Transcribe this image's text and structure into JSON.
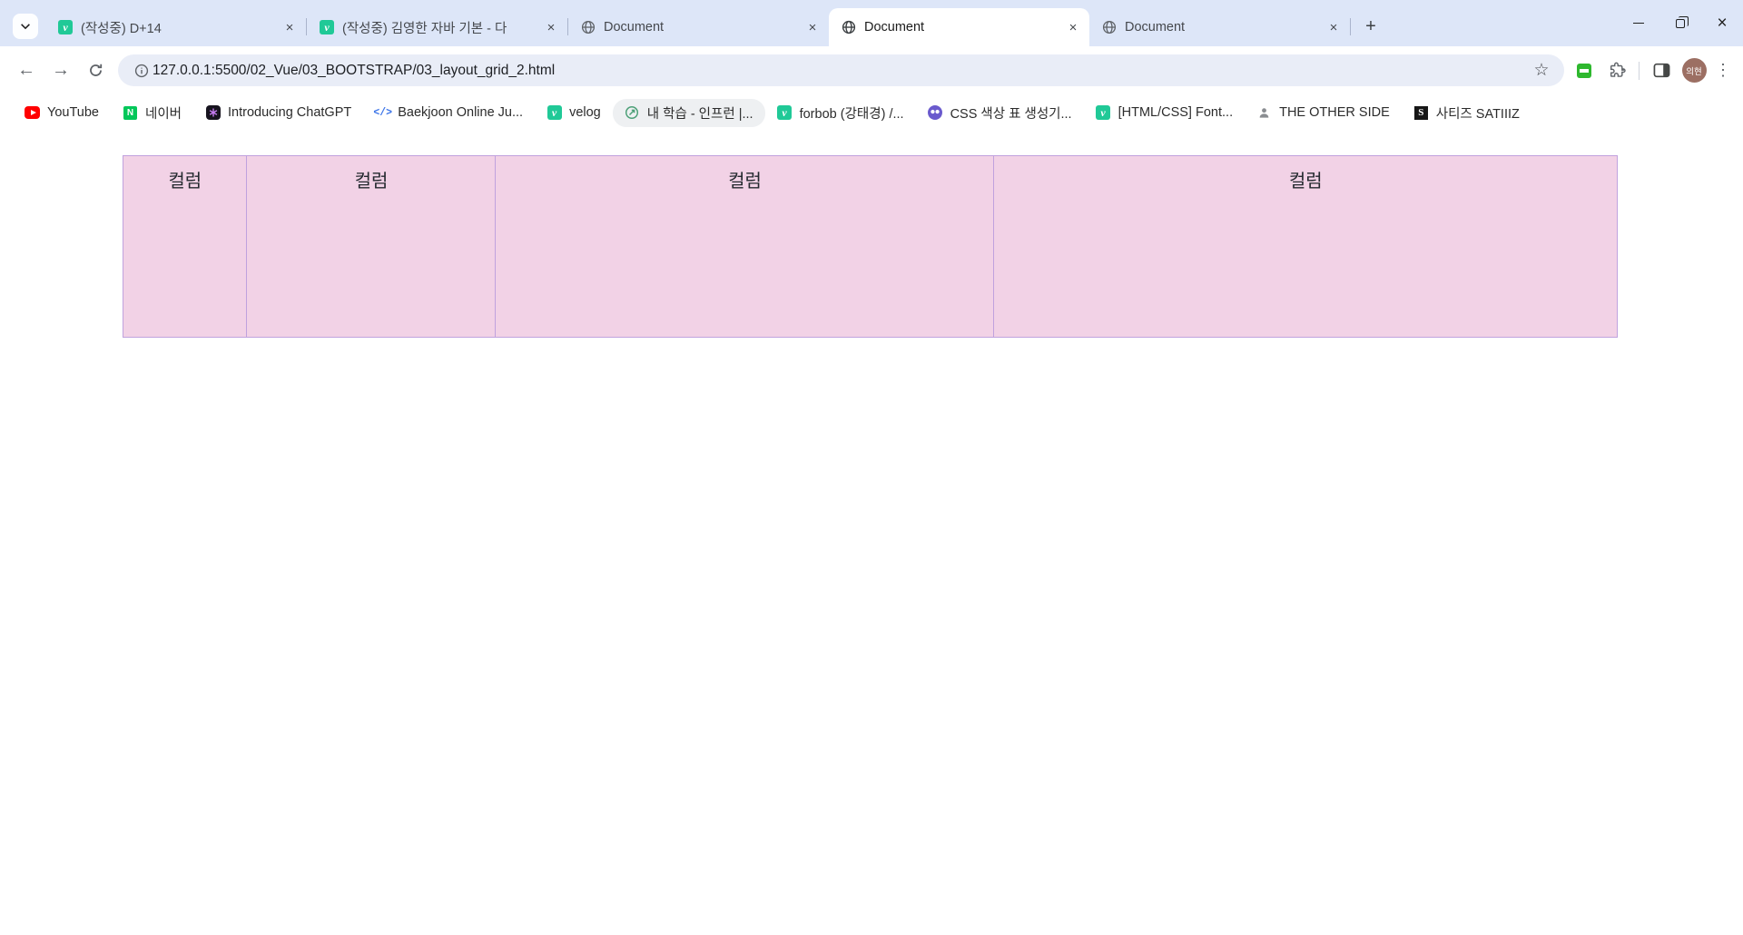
{
  "browser": {
    "tabs": [
      {
        "title": "(작성중) D+14",
        "icon": "velog",
        "active": false
      },
      {
        "title": "(작성중) 김영한 자바 기본 - 다",
        "icon": "velog",
        "active": false
      },
      {
        "title": "Document",
        "icon": "globe",
        "active": false
      },
      {
        "title": "Document",
        "icon": "globe",
        "active": true
      },
      {
        "title": "Document",
        "icon": "globe",
        "active": false
      }
    ],
    "url": "127.0.0.1:5500/02_Vue/03_BOOTSTRAP/03_layout_grid_2.html",
    "profile": {
      "initials": "의현"
    },
    "bookmarks": [
      {
        "label": "YouTube",
        "icon": "youtube-icon"
      },
      {
        "label": "네이버",
        "icon": "naver-icon"
      },
      {
        "label": "Introducing ChatGPT",
        "icon": "chatgpt-icon"
      },
      {
        "label": "Baekjoon Online Ju...",
        "icon": "code-icon"
      },
      {
        "label": "velog",
        "icon": "velog-icon"
      },
      {
        "label": "내 학습 - 인프런 |...",
        "icon": "inflearn-icon",
        "highlighted": true
      },
      {
        "label": "forbob (강태경) /...",
        "icon": "velog-icon"
      },
      {
        "label": "CSS 색상 표 생성기...",
        "icon": "css-color-icon"
      },
      {
        "label": "[HTML/CSS] Font...",
        "icon": "velog-icon"
      },
      {
        "label": "THE OTHER SIDE",
        "icon": "person-icon"
      },
      {
        "label": "사티즈 SATIIIZ",
        "icon": "satiiz-icon"
      }
    ]
  },
  "glyphs": {
    "velog": "v",
    "naver": "N",
    "satiiz": "S",
    "code": "</>",
    "close": "×",
    "plus": "+",
    "back": "←",
    "forward": "→",
    "star": "☆",
    "dots": "⋮"
  },
  "content": {
    "columns": [
      {
        "label": "컬럼",
        "span": 1
      },
      {
        "label": "컬럼",
        "span": 2
      },
      {
        "label": "컬럼",
        "span": 4
      },
      {
        "label": "컬럼",
        "span": 5
      }
    ],
    "colors": {
      "column_bg": "#f2d2e6",
      "column_border": "#c0a2de",
      "tabstrip_bg": "#dde6f8"
    }
  }
}
